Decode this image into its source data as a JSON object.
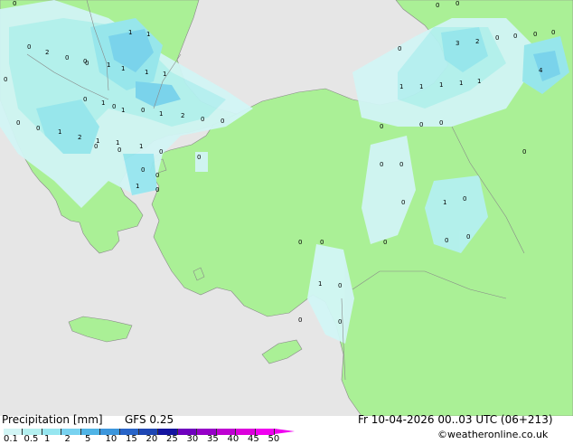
{
  "title_left": "Precipitation [mm]",
  "model": "GFS 0.25",
  "valid_time": "Fr 10-04-2026 00..03 UTC (06+213)",
  "credit": "©weatheronline.co.uk",
  "colors": {
    "sea": "#e6e6e6",
    "land": "#aaf096",
    "border": "#888888"
  },
  "legend": {
    "ticks": [
      "0.1",
      "0.5",
      "1",
      "2",
      "5",
      "10",
      "15",
      "20",
      "25",
      "30",
      "35",
      "40",
      "45",
      "50"
    ],
    "colors": [
      "#d2f5f5",
      "#b4f0f0",
      "#96e6f0",
      "#78d2f0",
      "#50b4e6",
      "#3c96dc",
      "#2864c8",
      "#1e46b4",
      "#1414a0",
      "#6e00be",
      "#9600c8",
      "#be00d2",
      "#dc00dc",
      "#f000f0"
    ]
  },
  "map_values": [
    {
      "t": "0"
    },
    {
      "t": "1"
    },
    {
      "t": "1"
    },
    {
      "t": "2"
    },
    {
      "t": "0"
    },
    {
      "t": "0"
    },
    {
      "t": "1"
    },
    {
      "t": "1"
    },
    {
      "t": "1"
    },
    {
      "t": "1"
    },
    {
      "t": "0"
    },
    {
      "t": "0"
    },
    {
      "t": "0"
    },
    {
      "t": "1"
    },
    {
      "t": "0"
    },
    {
      "t": "1"
    },
    {
      "t": "0"
    },
    {
      "t": "1"
    },
    {
      "t": "2"
    },
    {
      "t": "0"
    },
    {
      "t": "0"
    },
    {
      "t": "0"
    },
    {
      "t": "0"
    },
    {
      "t": "1"
    },
    {
      "t": "2"
    },
    {
      "t": "1"
    },
    {
      "t": "1"
    },
    {
      "t": "1"
    },
    {
      "t": "0"
    },
    {
      "t": "0"
    },
    {
      "t": "1"
    },
    {
      "t": "0"
    },
    {
      "t": "0"
    },
    {
      "t": "0"
    },
    {
      "t": "0"
    },
    {
      "t": "0"
    },
    {
      "t": "3"
    },
    {
      "t": "2"
    },
    {
      "t": "0"
    },
    {
      "t": "0"
    },
    {
      "t": "0"
    },
    {
      "t": "0"
    },
    {
      "t": "0"
    },
    {
      "t": "4"
    },
    {
      "t": "1"
    },
    {
      "t": "0"
    },
    {
      "t": "1"
    },
    {
      "t": "1"
    },
    {
      "t": "1"
    },
    {
      "t": "1"
    },
    {
      "t": "0"
    },
    {
      "t": "0"
    },
    {
      "t": "0"
    },
    {
      "t": "0"
    },
    {
      "t": "0"
    },
    {
      "t": "0"
    },
    {
      "t": "0"
    },
    {
      "t": "0"
    },
    {
      "t": "0"
    },
    {
      "t": "1"
    },
    {
      "t": "0"
    },
    {
      "t": "0"
    },
    {
      "t": "1"
    },
    {
      "t": "0"
    },
    {
      "t": "0"
    },
    {
      "t": "0"
    },
    {
      "t": "0"
    },
    {
      "t": "0"
    },
    {
      "t": "0"
    },
    {
      "t": "0"
    }
  ]
}
